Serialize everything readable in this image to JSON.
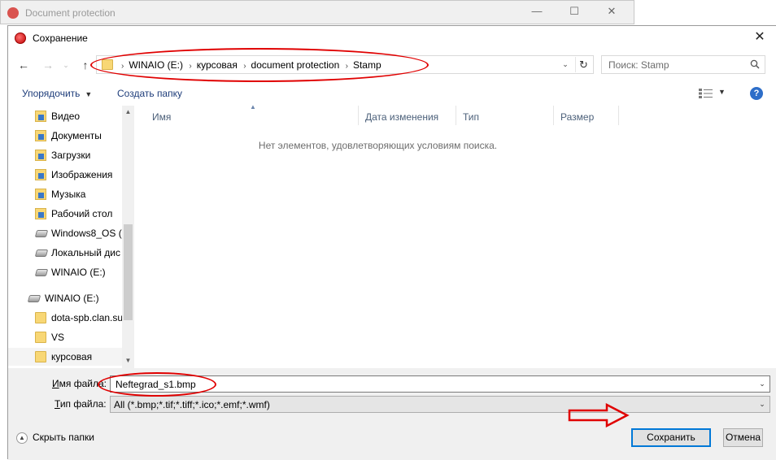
{
  "background_window": {
    "title": "Document protection",
    "minimize_glyph": "—",
    "maximize_glyph": "☐",
    "close_glyph": "✕"
  },
  "dialog": {
    "title": "Сохранение",
    "close_glyph": "✕",
    "nav": {
      "back_glyph": "←",
      "forward_glyph": "→",
      "up_glyph": "↑",
      "breadcrumbs": [
        "WINAIO (E:)",
        "курсовая",
        "document protection",
        "Stamp"
      ],
      "separator": "›",
      "dropdown_glyph": "⌄",
      "refresh_glyph": "↻"
    },
    "search": {
      "placeholder": "Поиск: Stamp"
    },
    "toolbar": {
      "organize_label": "Упорядочить",
      "new_folder_label": "Создать папку",
      "caret_glyph": "▼",
      "help_glyph": "?"
    },
    "nav_pane": {
      "items": [
        {
          "label": "Видео",
          "icon": "video-folder-icon"
        },
        {
          "label": "Документы",
          "icon": "documents-folder-icon"
        },
        {
          "label": "Загрузки",
          "icon": "downloads-folder-icon"
        },
        {
          "label": "Изображения",
          "icon": "pictures-folder-icon"
        },
        {
          "label": "Музыка",
          "icon": "music-folder-icon"
        },
        {
          "label": "Рабочий стол",
          "icon": "desktop-folder-icon"
        },
        {
          "label": "Windows8_OS (C",
          "icon": "drive-icon"
        },
        {
          "label": "Локальный дис",
          "icon": "drive-icon"
        },
        {
          "label": "WINAIO (E:)",
          "icon": "drive-icon"
        },
        {
          "label": "WINAIO (E:)",
          "icon": "drive-icon"
        },
        {
          "label": "dota-spb.clan.su",
          "icon": "folder-icon"
        },
        {
          "label": "VS",
          "icon": "folder-icon"
        },
        {
          "label": "курсовая",
          "icon": "folder-icon"
        }
      ],
      "scroll_up_glyph": "▲",
      "scroll_down_glyph": "▼"
    },
    "columns": [
      "Имя",
      "Дата изменения",
      "Тип",
      "Размер"
    ],
    "sort_glyph": "▲",
    "empty_message": "Нет элементов, удовлетворяющих условиям поиска.",
    "filename": {
      "label_underlined": "И",
      "label_rest": "мя файла:",
      "value": "Neftegrad_s1.bmp"
    },
    "filetype": {
      "label_underlined": "Т",
      "label_rest": "ип файла:",
      "value": "All (*.bmp;*.tif;*.tiff;*.ico;*.emf;*.wmf)"
    },
    "hide_folders_label": "Скрыть папки",
    "hide_folders_glyph": "▲",
    "save_label": "Сохранить",
    "cancel_label": "Отмена"
  }
}
